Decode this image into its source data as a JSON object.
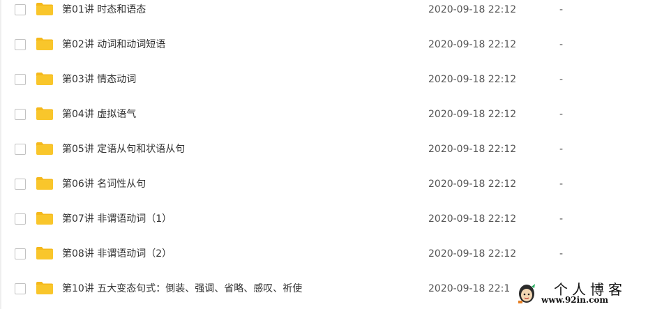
{
  "files": [
    {
      "name": "第01讲 时态和语态",
      "date": "2020-09-18 22:12",
      "size": "-"
    },
    {
      "name": "第02讲 动词和动词短语",
      "date": "2020-09-18 22:12",
      "size": "-"
    },
    {
      "name": "第03讲 情态动词",
      "date": "2020-09-18 22:12",
      "size": "-"
    },
    {
      "name": "第04讲 虚拟语气",
      "date": "2020-09-18 22:12",
      "size": "-"
    },
    {
      "name": "第05讲 定语从句和状语从句",
      "date": "2020-09-18 22:12",
      "size": "-"
    },
    {
      "name": "第06讲 名词性从句",
      "date": "2020-09-18 22:12",
      "size": "-"
    },
    {
      "name": "第07讲 非谓语动词（1）",
      "date": "2020-09-18 22:12",
      "size": "-"
    },
    {
      "name": "第08讲 非谓语动词（2）",
      "date": "2020-09-18 22:12",
      "size": "-"
    },
    {
      "name": "第10讲 五大变态句式：倒装、强调、省略、感叹、祈使",
      "date": "2020-09-18 22:1",
      "size": "-"
    }
  ],
  "watermark": {
    "title": "个人博客",
    "url": "www.92in.com"
  },
  "colors": {
    "folder": "#f9c62b",
    "folder_tab": "#f5b81b",
    "checkbox_border": "#c2c2c2",
    "text": "#333333"
  },
  "icons": {
    "row_checkbox": "checkbox-icon",
    "row_folder": "folder-icon",
    "watermark_logo": "avatar-icon"
  }
}
